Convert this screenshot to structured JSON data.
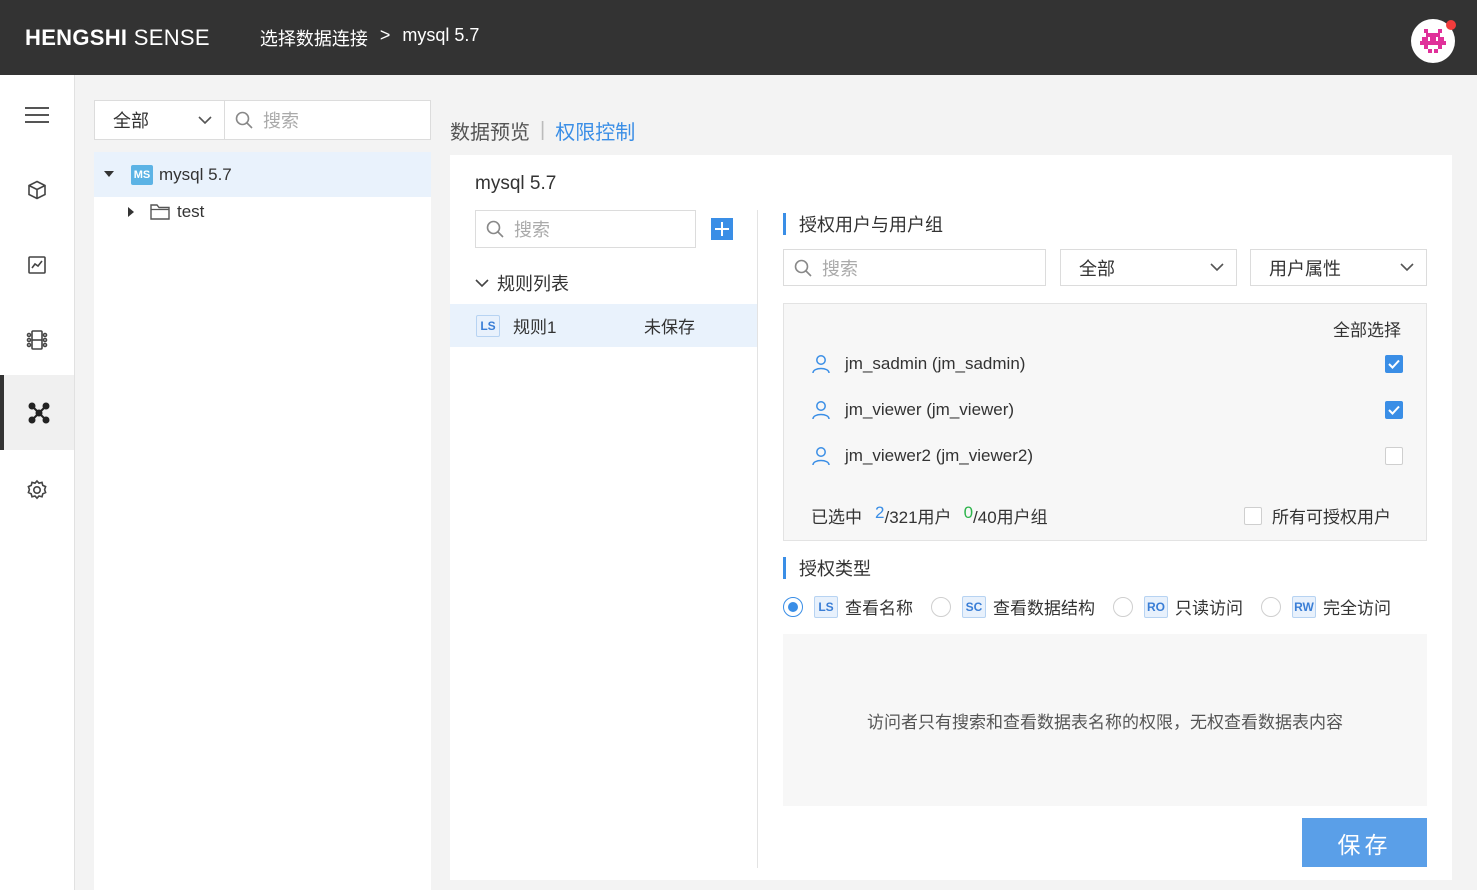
{
  "header": {
    "brand_bold": "HENGSHI",
    "brand_light": "SENSE",
    "breadcrumb": [
      "选择数据连接",
      ">",
      "mysql 5.7"
    ]
  },
  "tree_panel": {
    "filter_value": "全部",
    "search_placeholder": "搜索",
    "nodes": [
      {
        "badge": "MS",
        "label": "mysql 5.7",
        "expanded": true
      },
      {
        "label": "test",
        "expanded": false
      }
    ]
  },
  "tabs": {
    "preview": "数据预览",
    "permission": "权限控制"
  },
  "rules": {
    "connection_title": "mysql 5.7",
    "search_placeholder": "搜索",
    "list_header": "规则列表",
    "items": [
      {
        "badge": "LS",
        "name": "规则1",
        "status": "未保存"
      }
    ]
  },
  "authorization": {
    "title": "授权用户与用户组",
    "search_placeholder": "搜索",
    "filter_value": "全部",
    "attribute_value": "用户属性",
    "select_all": "全部选择",
    "users": [
      {
        "name": "jm_sadmin (jm_sadmin)",
        "checked": true
      },
      {
        "name": "jm_viewer (jm_viewer)",
        "checked": true
      },
      {
        "name": "jm_viewer2 (jm_viewer2)",
        "checked": false
      }
    ],
    "summary_prefix": "已选中",
    "selected_users": "2",
    "total_users": "/321用户",
    "selected_groups": "0",
    "total_groups": "/40用户组",
    "all_authorizable": "所有可授权用户"
  },
  "auth_type": {
    "title": "授权类型",
    "options": [
      {
        "badge": "LS",
        "label": "查看名称",
        "selected": true
      },
      {
        "badge": "SC",
        "label": "查看数据结构",
        "selected": false
      },
      {
        "badge": "RO",
        "label": "只读访问",
        "selected": false
      },
      {
        "badge": "RW",
        "label": "完全访问",
        "selected": false
      }
    ],
    "description": "访问者只有搜索和查看数据表名称的权限，无权查看数据表内容"
  },
  "actions": {
    "save_label": "保存"
  },
  "colors": {
    "accent": "#3a8ee6",
    "header_bg": "#333333",
    "green": "#2db44b"
  }
}
